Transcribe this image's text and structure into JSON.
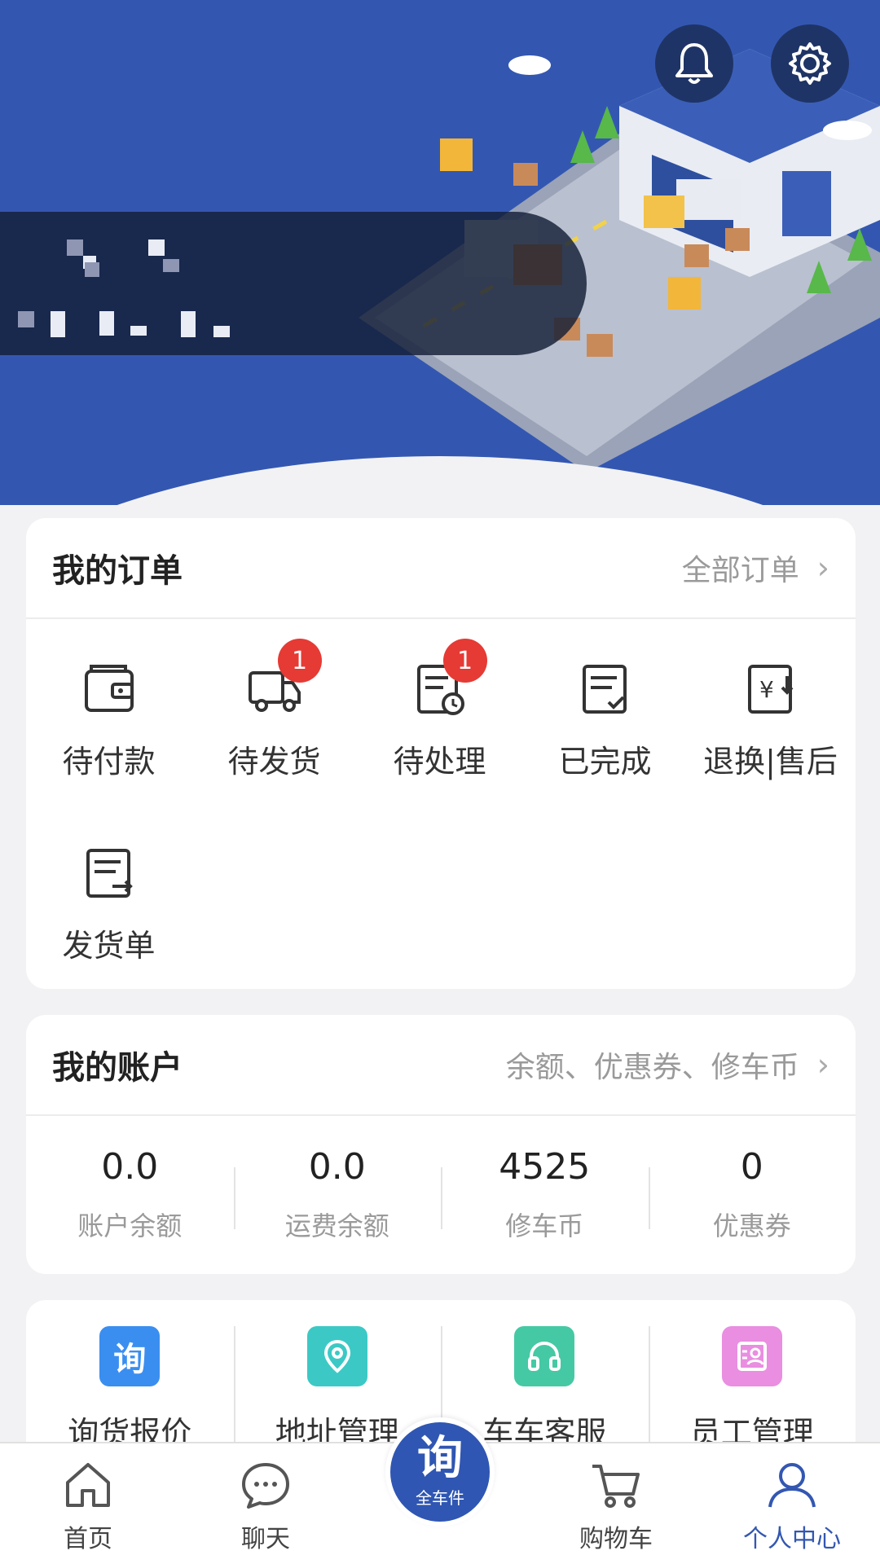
{
  "header": {
    "bell_icon": "bell-icon",
    "settings_icon": "gear-icon"
  },
  "orders": {
    "title": "我的订单",
    "link": "全部订单",
    "items": [
      {
        "label": "待付款",
        "icon": "wallet-icon",
        "badge": ""
      },
      {
        "label": "待发货",
        "icon": "truck-icon",
        "badge": "1"
      },
      {
        "label": "待处理",
        "icon": "clock-doc-icon",
        "badge": "1"
      },
      {
        "label": "已完成",
        "icon": "check-doc-icon",
        "badge": ""
      },
      {
        "label": "退换|售后",
        "icon": "refund-icon",
        "badge": ""
      },
      {
        "label": "发货单",
        "icon": "shipping-doc-icon",
        "badge": ""
      }
    ]
  },
  "account": {
    "title": "我的账户",
    "link": "余额、优惠券、修车币",
    "stats": [
      {
        "value": "0.0",
        "label": "账户余额"
      },
      {
        "value": "0.0",
        "label": "运费余额"
      },
      {
        "value": "4525",
        "label": "修车币"
      },
      {
        "value": "0",
        "label": "优惠券"
      }
    ]
  },
  "services": [
    {
      "label": "询货报价",
      "glyph": "询",
      "color": "#3a8ef0"
    },
    {
      "label": "地址管理",
      "glyph": "",
      "color": "#3cc9c5"
    },
    {
      "label": "车车客服",
      "glyph": "",
      "color": "#45c9a4"
    },
    {
      "label": "员工管理",
      "glyph": "",
      "color": "#e98ee0"
    }
  ],
  "tabbar": {
    "home": "首页",
    "chat": "聊天",
    "center_glyph": "询",
    "center_label": "全车件",
    "cart": "购物车",
    "profile": "个人中心"
  },
  "colors": {
    "primary": "#3357b1",
    "badge": "#e63a35"
  }
}
